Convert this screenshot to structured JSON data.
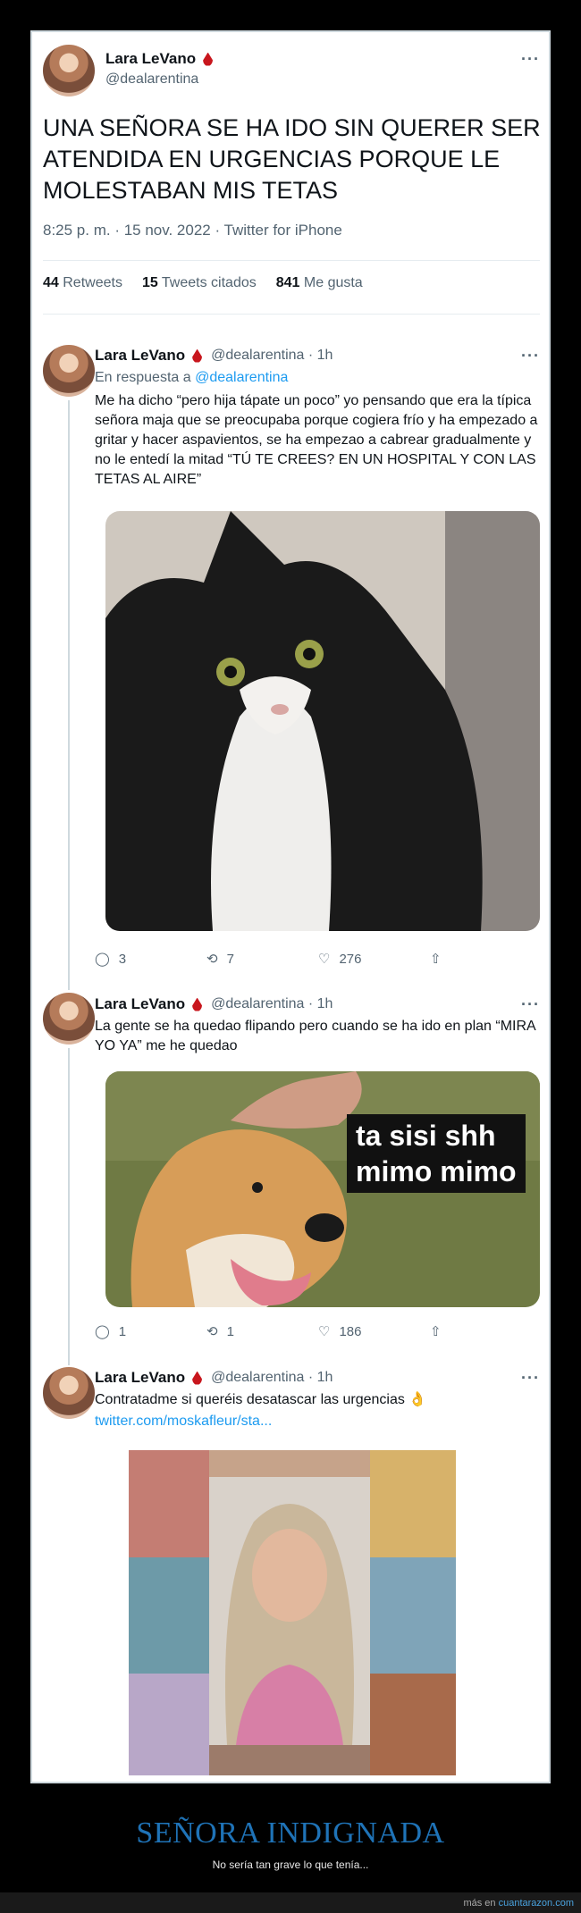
{
  "main_tweet": {
    "name": "Lara LeVano",
    "handle": "@dealarentina",
    "text": "UNA SEÑORA SE HA IDO SIN QUERER SER ATENDIDA EN URGENCIAS PORQUE LE MOLESTABAN MIS TETAS",
    "meta": "8:25 p. m. · 15 nov. 2022 · Twitter for iPhone",
    "retweets_count": "44",
    "retweets_label": "Retweets",
    "quotes_count": "15",
    "quotes_label": "Tweets citados",
    "likes_count": "841",
    "likes_label": "Me gusta"
  },
  "replies": [
    {
      "name": "Lara LeVano",
      "handle": "@dealarentina · 1h",
      "in_reply_prefix": "En respuesta a ",
      "in_reply_handle": "@dealarentina",
      "text": "Me ha dicho “pero hija tápate un poco” yo pensando que era la típica señora maja que se preocupaba porque cogiera frío y ha empezado a gritar y hacer aspavientos, se ha empezao a cabrear gradualmente y no le entedí la mitad  “TÚ TE CREES? EN UN HOSPITAL Y CON LAS TETAS AL AIRE”",
      "replies_count": "3",
      "retweets_count": "7",
      "likes_count": "276"
    },
    {
      "name": "Lara LeVano",
      "handle": "@dealarentina · 1h",
      "text": "La gente se ha quedao flipando pero cuando se ha ido en plan “MIRA YO YA” me he quedao",
      "image_caption_line1": "ta sisi shh",
      "image_caption_line2": "mimo mimo",
      "replies_count": "1",
      "retweets_count": "1",
      "likes_count": "186"
    },
    {
      "name": "Lara LeVano",
      "handle": "@dealarentina · 1h",
      "text": "Contratadme si queréis desatascar las urgencias 👌",
      "link": "twitter.com/moskafleur/sta..."
    }
  ],
  "footer": {
    "title": "SEÑORA INDIGNADA",
    "subtitle": "No sería tan grave lo que tenía...",
    "credit_prefix": "más en ",
    "credit_site": "cuantarazon.com"
  },
  "colors": {
    "link": "#1d9bf0",
    "blood_drop": "#c8161d",
    "footer_title": "#1f73b7"
  }
}
